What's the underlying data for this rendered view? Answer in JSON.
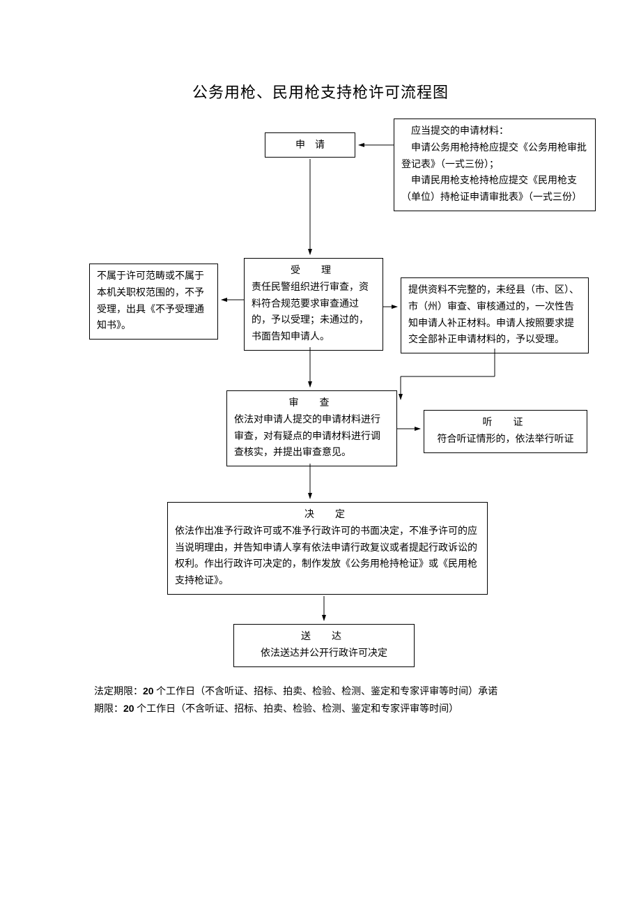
{
  "title": "公务用枪、民用枪支持枪许可流程图",
  "nodes": {
    "apply": {
      "title": "申　请"
    },
    "materials": {
      "l1": "应当提交的申请材料：",
      "l2": "申请公务用枪持枪应提交《公务用枪审批登记表》（一式三份）；",
      "l3": "申请民用枪支枪持枪应提交《民用枪支（单位）持枪证申请审批表》（一式三份）"
    },
    "accept": {
      "title": "受　理",
      "body": "责任民警组织进行审查，资料符合规范要求审查通过的，予以受理；未通过的，书面告知申请人。"
    },
    "reject_left": {
      "body": "不属于许可范畴或不属于本机关职权范围的，不予受理，出具《不予受理通知书》。"
    },
    "incomplete_right": {
      "body": "提供资料不完整的，未经县（市、区）、市（州）审查、审核通过的，一次性告知申请人补正材料。申请人按照要求提交全部补正申请材料的，予以受理。"
    },
    "review": {
      "title": "审　查",
      "body": "依法对申请人提交的申请材料进行审查，对有疑点的申请材料进行调查核实，并提出审查意见。"
    },
    "hearing": {
      "title": "听　证",
      "body": "符合听证情形的，依法举行听证"
    },
    "decision": {
      "title": "决　定",
      "body": "依法作出准予行政许可或不准予行政许可的书面决定，不准予许可的应当说明理由，并告知申请人享有依法申请行政复议或者提起行政诉讼的权利。作出行政许可决定的，制作发放《公务用枪持枪证》或《民用枪支持枪证》。"
    },
    "deliver": {
      "title": "送　达",
      "body": "依法送达并公开行政许可决定"
    }
  },
  "footer": {
    "l1a": "法定期限：",
    "l1b": "20",
    "l1c": " 个工作日（不含听证、招标、拍卖、检验、检测、鉴定和专家评审等时间）承诺",
    "l2a": "期限：",
    "l2b": "20",
    "l2c": " 个工作日（不含听证、招标、拍卖、检验、检测、鉴定和专家评审等时间）"
  }
}
